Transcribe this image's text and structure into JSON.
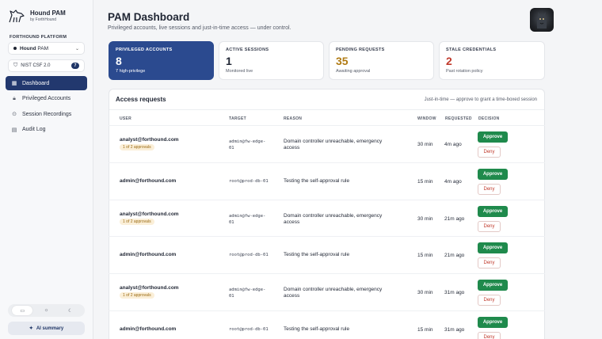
{
  "brand": {
    "title": "Hound PAM",
    "subtitle": "by ForthHound"
  },
  "sidebar": {
    "section_label": "FORTHOUND PLATFORM",
    "product_select": {
      "bold": "Hound",
      "rest": " PAM"
    },
    "compliance": {
      "label": "NIST CSF 2.0",
      "count": "7"
    },
    "items": [
      {
        "label": "Dashboard",
        "icon": "grid-icon"
      },
      {
        "label": "Privileged Accounts",
        "icon": "lock-icon"
      },
      {
        "label": "Session Recordings",
        "icon": "play-circle-icon"
      },
      {
        "label": "Audit Log",
        "icon": "document-icon"
      }
    ],
    "ai_summary": "AI summary"
  },
  "header": {
    "title": "PAM Dashboard",
    "subtitle": "Privileged accounts, live sessions and just-in-time access — under control."
  },
  "stats": [
    {
      "label": "PRIVILEGED ACCOUNTS",
      "value": "8",
      "note": "7 high-privilege",
      "color": "#ffffff"
    },
    {
      "label": "ACTIVE SESSIONS",
      "value": "1",
      "note": "Monitored live",
      "color": "#1f2533"
    },
    {
      "label": "PENDING REQUESTS",
      "value": "35",
      "note": "Awaiting approval",
      "color": "#b07a12"
    },
    {
      "label": "STALE CREDENTIALS",
      "value": "2",
      "note": "Past rotation policy",
      "color": "#c0392b"
    }
  ],
  "requests": {
    "title": "Access requests",
    "hint": "Just-in-time — approve to grant a time-boxed session",
    "columns": {
      "user": "USER",
      "target": "TARGET",
      "reason": "REASON",
      "window": "WINDOW",
      "requested": "REQUESTED",
      "decision": "DECISION"
    },
    "approve_label": "Approve",
    "deny_label": "Deny",
    "rows": [
      {
        "user": "analyst@forthound.com",
        "approvals": "1 of 2 approvals",
        "target1": "admin@fw-edge-",
        "target2": "01",
        "reason": "Domain controller unreachable, emergency access",
        "window": "30 min",
        "requested": "4m ago"
      },
      {
        "user": "admin@forthound.com",
        "approvals": "",
        "target1": "root@prod-db-01",
        "target2": "",
        "reason": "Testing the self-approval rule",
        "window": "15 min",
        "requested": "4m ago"
      },
      {
        "user": "analyst@forthound.com",
        "approvals": "1 of 2 approvals",
        "target1": "admin@fw-edge-",
        "target2": "01",
        "reason": "Domain controller unreachable, emergency access",
        "window": "30 min",
        "requested": "21m ago"
      },
      {
        "user": "admin@forthound.com",
        "approvals": "",
        "target1": "root@prod-db-01",
        "target2": "",
        "reason": "Testing the self-approval rule",
        "window": "15 min",
        "requested": "21m ago"
      },
      {
        "user": "analyst@forthound.com",
        "approvals": "1 of 2 approvals",
        "target1": "admin@fw-edge-",
        "target2": "01",
        "reason": "Domain controller unreachable, emergency access",
        "window": "30 min",
        "requested": "31m ago"
      },
      {
        "user": "admin@forthound.com",
        "approvals": "",
        "target1": "root@prod-db-01",
        "target2": "",
        "reason": "Testing the self-approval rule",
        "window": "15 min",
        "requested": "31m ago"
      }
    ]
  }
}
